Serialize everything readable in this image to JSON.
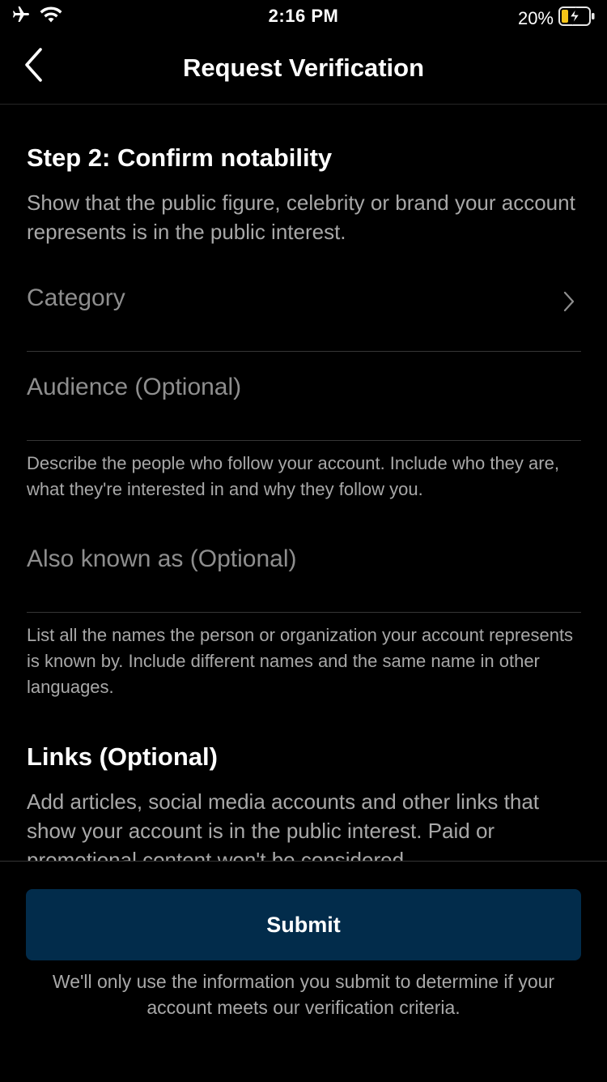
{
  "status_bar": {
    "time": "2:16 PM",
    "battery_percent": "20%",
    "icons": [
      "airplane-icon",
      "wifi-icon",
      "battery-charging-icon"
    ]
  },
  "nav": {
    "title": "Request Verification",
    "back_icon": "chevron-left-icon"
  },
  "step": {
    "title": "Step 2: Confirm notability",
    "description": "Show that the public figure, celebrity or brand your account represents is in the public interest."
  },
  "fields": {
    "category": {
      "label": "Category",
      "icon": "chevron-right-icon"
    },
    "audience": {
      "label": "Audience (Optional)",
      "help": "Describe the people who follow your account. Include who they are, what they're interested in and why they follow you."
    },
    "also_known_as": {
      "label": "Also known as (Optional)",
      "help": "List all the names the person or organization your account represents is known by. Include different names and the same name in other languages."
    }
  },
  "links": {
    "title": "Links (Optional)",
    "description": "Add articles, social media accounts and other links that show your account is in the public interest. Paid or promotional content won't be considered."
  },
  "footer": {
    "submit_label": "Submit",
    "note": "We'll only use the information you submit to determine if your account meets our verification criteria."
  },
  "colors": {
    "background": "#000000",
    "submit_button": "#022c4b",
    "secondary_text": "#a8a8a8",
    "field_label": "#8e8e8e",
    "battery_fill": "#f5c518",
    "divider": "#363636"
  }
}
